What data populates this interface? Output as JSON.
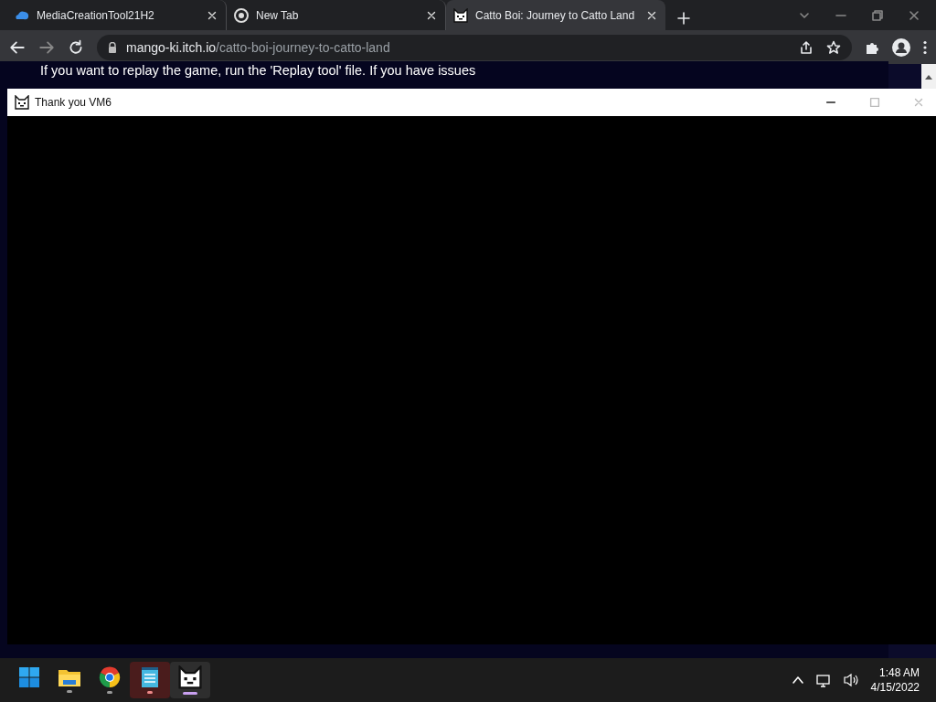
{
  "browser": {
    "tabs": [
      {
        "title": "MediaCreationTool21H2",
        "kind": "tool",
        "selected": false
      },
      {
        "title": "New Tab",
        "kind": "chrome",
        "selected": false
      },
      {
        "title": "Catto Boi: Journey to Catto Land",
        "kind": "cat",
        "selected": true
      }
    ],
    "address": {
      "host": "mango-ki.itch.io",
      "path": "/catto-boi-journey-to-catto-land"
    },
    "page_text": [
      "If you want to replay the game, run the 'Replay tool' file. If you have issues"
    ]
  },
  "game_window": {
    "title": "Thank you VM6"
  },
  "taskbar": {
    "apps": [
      {
        "kind": "start",
        "running": false,
        "active": false,
        "flashing": false
      },
      {
        "kind": "explorer",
        "running": true,
        "active": false,
        "flashing": false
      },
      {
        "kind": "chrome",
        "running": true,
        "active": false,
        "flashing": false
      },
      {
        "kind": "notepad",
        "running": true,
        "active": false,
        "flashing": true
      },
      {
        "kind": "cat",
        "running": true,
        "active": true,
        "flashing": false
      }
    ],
    "time": "1:48 AM",
    "date": "4/15/2022"
  }
}
